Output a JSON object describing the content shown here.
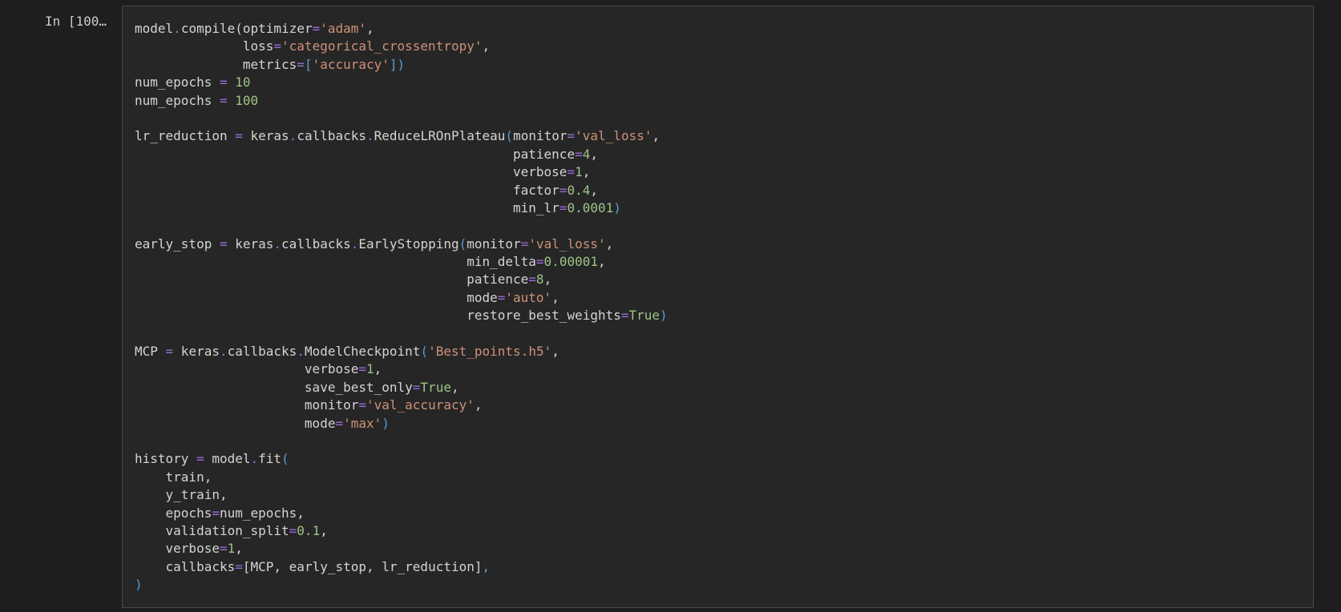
{
  "cell": {
    "prompt": "In [100…",
    "lines": [
      [
        {
          "t": "model"
        },
        {
          "t": ".",
          "c": "op"
        },
        {
          "t": "compile"
        },
        {
          "t": "("
        },
        {
          "t": "optimizer"
        },
        {
          "t": "=",
          "c": "op"
        },
        {
          "t": "'adam'",
          "c": "str"
        },
        {
          "t": ","
        }
      ],
      [
        {
          "t": "              loss"
        },
        {
          "t": "=",
          "c": "op"
        },
        {
          "t": "'categorical_crossentropy'",
          "c": "str"
        },
        {
          "t": ","
        }
      ],
      [
        {
          "t": "              metrics"
        },
        {
          "t": "=",
          "c": "op"
        },
        {
          "t": "[",
          "c": "paren"
        },
        {
          "t": "'accuracy'",
          "c": "str"
        },
        {
          "t": "])",
          "c": "paren"
        }
      ],
      [
        {
          "t": "num_epochs "
        },
        {
          "t": "=",
          "c": "op"
        },
        {
          "t": " "
        },
        {
          "t": "10",
          "c": "num"
        }
      ],
      [
        {
          "t": "num_epochs "
        },
        {
          "t": "=",
          "c": "op"
        },
        {
          "t": " "
        },
        {
          "t": "100",
          "c": "num"
        }
      ],
      [],
      [
        {
          "t": "lr_reduction "
        },
        {
          "t": "=",
          "c": "op"
        },
        {
          "t": " keras"
        },
        {
          "t": ".",
          "c": "op"
        },
        {
          "t": "callbacks"
        },
        {
          "t": ".",
          "c": "op"
        },
        {
          "t": "ReduceLROnPlateau"
        },
        {
          "t": "(",
          "c": "paren"
        },
        {
          "t": "monitor"
        },
        {
          "t": "=",
          "c": "op"
        },
        {
          "t": "'val_loss'",
          "c": "str"
        },
        {
          "t": ","
        }
      ],
      [
        {
          "t": "                                                 patience"
        },
        {
          "t": "=",
          "c": "op"
        },
        {
          "t": "4",
          "c": "num"
        },
        {
          "t": ","
        }
      ],
      [
        {
          "t": "                                                 verbose"
        },
        {
          "t": "=",
          "c": "op"
        },
        {
          "t": "1",
          "c": "num"
        },
        {
          "t": ","
        }
      ],
      [
        {
          "t": "                                                 factor"
        },
        {
          "t": "=",
          "c": "op"
        },
        {
          "t": "0.4",
          "c": "num"
        },
        {
          "t": ","
        }
      ],
      [
        {
          "t": "                                                 min_lr"
        },
        {
          "t": "=",
          "c": "op"
        },
        {
          "t": "0.0001",
          "c": "num"
        },
        {
          "t": ")",
          "c": "paren"
        }
      ],
      [],
      [
        {
          "t": "early_stop "
        },
        {
          "t": "=",
          "c": "op"
        },
        {
          "t": " keras"
        },
        {
          "t": ".",
          "c": "op"
        },
        {
          "t": "callbacks"
        },
        {
          "t": ".",
          "c": "op"
        },
        {
          "t": "EarlyStopping"
        },
        {
          "t": "(",
          "c": "paren"
        },
        {
          "t": "monitor"
        },
        {
          "t": "=",
          "c": "op"
        },
        {
          "t": "'val_loss'",
          "c": "str"
        },
        {
          "t": ","
        }
      ],
      [
        {
          "t": "                                           min_delta"
        },
        {
          "t": "=",
          "c": "op"
        },
        {
          "t": "0.00001",
          "c": "num"
        },
        {
          "t": ","
        }
      ],
      [
        {
          "t": "                                           patience"
        },
        {
          "t": "=",
          "c": "op"
        },
        {
          "t": "8",
          "c": "num"
        },
        {
          "t": ","
        }
      ],
      [
        {
          "t": "                                           mode"
        },
        {
          "t": "=",
          "c": "op"
        },
        {
          "t": "'auto'",
          "c": "str"
        },
        {
          "t": ","
        }
      ],
      [
        {
          "t": "                                           restore_best_weights"
        },
        {
          "t": "=",
          "c": "op"
        },
        {
          "t": "True",
          "c": "kw"
        },
        {
          "t": ")",
          "c": "paren"
        }
      ],
      [],
      [
        {
          "t": "MCP "
        },
        {
          "t": "=",
          "c": "op"
        },
        {
          "t": " keras"
        },
        {
          "t": ".",
          "c": "op"
        },
        {
          "t": "callbacks"
        },
        {
          "t": ".",
          "c": "op"
        },
        {
          "t": "ModelCheckpoint"
        },
        {
          "t": "(",
          "c": "paren"
        },
        {
          "t": "'Best_points.h5'",
          "c": "str"
        },
        {
          "t": ","
        }
      ],
      [
        {
          "t": "                      verbose"
        },
        {
          "t": "=",
          "c": "op"
        },
        {
          "t": "1",
          "c": "num"
        },
        {
          "t": ","
        }
      ],
      [
        {
          "t": "                      save_best_only"
        },
        {
          "t": "=",
          "c": "op"
        },
        {
          "t": "True",
          "c": "kw"
        },
        {
          "t": ","
        }
      ],
      [
        {
          "t": "                      monitor"
        },
        {
          "t": "=",
          "c": "op"
        },
        {
          "t": "'val_accuracy'",
          "c": "str"
        },
        {
          "t": ","
        }
      ],
      [
        {
          "t": "                      mode"
        },
        {
          "t": "=",
          "c": "op"
        },
        {
          "t": "'max'",
          "c": "str"
        },
        {
          "t": ")",
          "c": "paren"
        }
      ],
      [],
      [
        {
          "t": "history "
        },
        {
          "t": "=",
          "c": "op"
        },
        {
          "t": " model"
        },
        {
          "t": ".",
          "c": "op"
        },
        {
          "t": "fit"
        },
        {
          "t": "(",
          "c": "paren"
        }
      ],
      [
        {
          "t": "    train,"
        }
      ],
      [
        {
          "t": "    y_train,"
        }
      ],
      [
        {
          "t": "    epochs"
        },
        {
          "t": "=",
          "c": "op"
        },
        {
          "t": "num_epochs,"
        }
      ],
      [
        {
          "t": "    validation_split"
        },
        {
          "t": "=",
          "c": "op"
        },
        {
          "t": "0.1",
          "c": "num"
        },
        {
          "t": ","
        }
      ],
      [
        {
          "t": "    verbose"
        },
        {
          "t": "=",
          "c": "op"
        },
        {
          "t": "1",
          "c": "num"
        },
        {
          "t": ","
        }
      ],
      [
        {
          "t": "    callbacks"
        },
        {
          "t": "=",
          "c": "op"
        },
        {
          "t": "[MCP, early_stop, lr_reduction]"
        },
        {
          "t": ",",
          "c": "paren"
        }
      ],
      [
        {
          "t": ")",
          "c": "paren"
        }
      ]
    ]
  },
  "colors": {
    "background": "#1e1e1e",
    "cell_background": "#262626",
    "cell_border": "#474747",
    "text": "#d4d4d4",
    "operator": "#9b6bd8",
    "string": "#ce9178",
    "number": "#9cc488",
    "bracket": "#569cd6"
  }
}
